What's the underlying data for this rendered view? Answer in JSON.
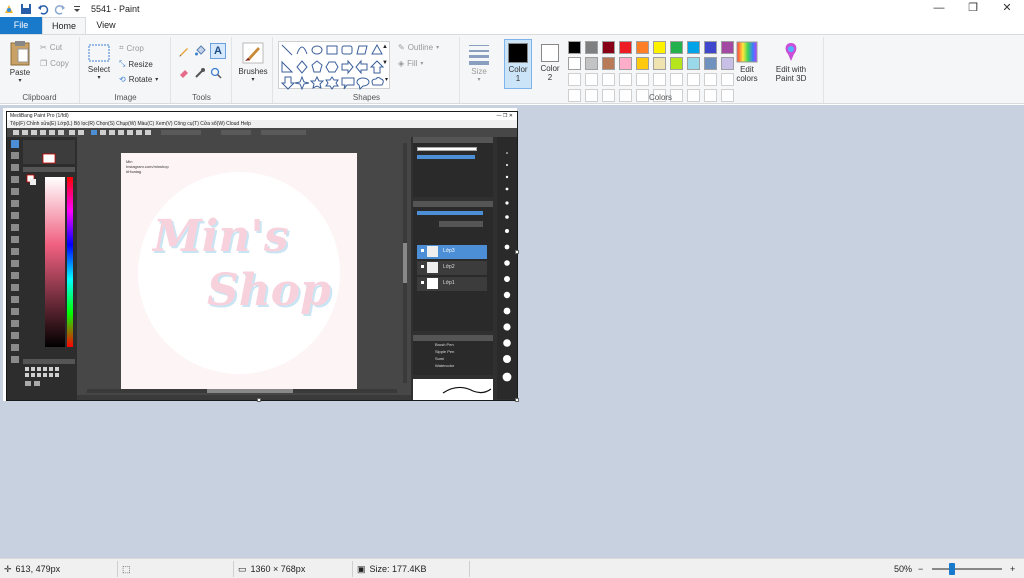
{
  "window": {
    "title": "5541 - Paint",
    "controls": {
      "minimize": "—",
      "restore": "❐",
      "close": "✕"
    }
  },
  "tabs": [
    {
      "label": "File"
    },
    {
      "label": "Home"
    },
    {
      "label": "View"
    }
  ],
  "clipboard": {
    "label": "Clipboard",
    "paste": "Paste",
    "cut": "Cut",
    "copy": "Copy"
  },
  "image": {
    "label": "Image",
    "select": "Select",
    "crop": "Crop",
    "resize": "Resize",
    "rotate": "Rotate"
  },
  "tools": {
    "label": "Tools"
  },
  "brushes": {
    "label": "Brushes"
  },
  "shapes": {
    "label": "Shapes",
    "outline": "Outline",
    "fill": "Fill"
  },
  "size": {
    "label": "Size"
  },
  "colors": {
    "label": "Colors",
    "color1": "Color\n1",
    "color1_a": "Color",
    "color1_b": "1",
    "color2_a": "Color",
    "color2_b": "2",
    "edit_colors_a": "Edit",
    "edit_colors_b": "colors",
    "paint3d_a": "Edit with",
    "paint3d_b": "Paint 3D",
    "palette_row1": [
      "#000000",
      "#7f7f7f",
      "#880015",
      "#ed1c24",
      "#ff7f27",
      "#fff200",
      "#22b14c",
      "#00a2e8",
      "#3f48cc",
      "#a349a4"
    ],
    "palette_row2": [
      "#ffffff",
      "#c3c3c3",
      "#b97a57",
      "#ffaec9",
      "#ffc90e",
      "#efe4b0",
      "#b5e61d",
      "#99d9ea",
      "#7092be",
      "#c8bfe7"
    ],
    "accent": "#1979ca"
  },
  "embedded": {
    "title": "MediBang Paint Pro (1/fdl)",
    "menu": "Tệp(F)   Chỉnh sửa(E)   Lớp(L)   Bộ lọc(R)   Chọn(S)   Chụp(W)   Màu(C)   Xem(V)   Công cụ(T)   Cửa sổ(W)   Cloud   Help",
    "canvas_note_1": "Min",
    "canvas_note_2": "Instagram.com/minshop",
    "canvas_note_3": "#Hoatag",
    "logo_text_1": "Min's",
    "logo_text_2": "Shop",
    "layers": [
      "Lớp3",
      "Lớp2",
      "Lớp1"
    ],
    "brushes": [
      "Brush Pen",
      "Sipple Pen",
      "Sumi",
      "Watercolor"
    ]
  },
  "status": {
    "cursor": "613, 479px",
    "dimensions": "1360 × 768px",
    "size": "Size: 177.4KB",
    "zoom": "50%",
    "zoom_minus": "−",
    "zoom_plus": "+"
  }
}
